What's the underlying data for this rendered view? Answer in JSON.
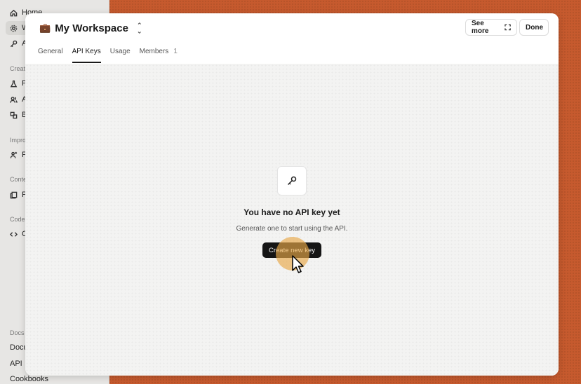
{
  "sidebar": {
    "items": [
      {
        "label": "Home",
        "icon": "home-icon"
      },
      {
        "label": "W",
        "icon": "gear-icon"
      },
      {
        "label": "A",
        "icon": "key-icon"
      }
    ],
    "sections": [
      {
        "title": "Create",
        "items": [
          {
            "label": "Pl",
            "icon": "flask-icon"
          },
          {
            "label": "A",
            "icon": "users-icon"
          },
          {
            "label": "Ba",
            "icon": "batch-icon"
          }
        ]
      },
      {
        "title": "Improv",
        "items": [
          {
            "label": "Fi",
            "icon": "sparkle-person-icon"
          }
        ]
      },
      {
        "title": "Conte",
        "items": [
          {
            "label": "Fi",
            "icon": "files-icon"
          }
        ]
      },
      {
        "title": "Code",
        "items": [
          {
            "label": "C",
            "icon": "code-icon"
          }
        ]
      }
    ],
    "docs": {
      "title": "Docs",
      "links": [
        "Docu",
        "API",
        "Cookbooks"
      ]
    }
  },
  "modal": {
    "workspace_emoji": "💼",
    "workspace_name": "My Workspace",
    "see_more": "See more",
    "done": "Done",
    "tabs": [
      {
        "label": "General"
      },
      {
        "label": "API Keys",
        "active": true
      },
      {
        "label": "Usage"
      },
      {
        "label": "Members",
        "count": "1"
      }
    ],
    "empty_state": {
      "title": "You have no API key yet",
      "subtitle": "Generate one to start using the API.",
      "button": "Create new key"
    }
  },
  "colors": {
    "background": "#c65a2e",
    "button": "#151515",
    "highlight": "#e8a846"
  }
}
